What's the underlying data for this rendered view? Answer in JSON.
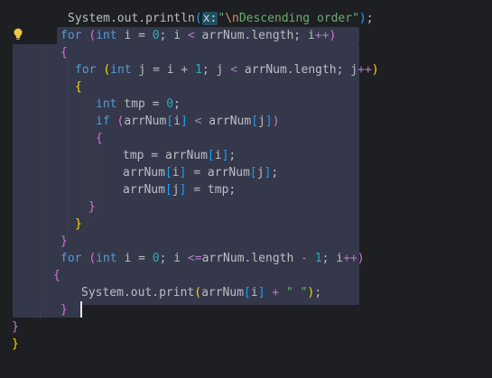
{
  "editor": {
    "icons": {
      "intention_bulb": "lightbulb-icon"
    },
    "colors": {
      "background": "#1e1f22",
      "selection": "#34384a",
      "keyword": "#569cd6",
      "number": "#2aacb8",
      "string": "#6aab73",
      "bracket_gold": "#ffd700",
      "bracket_magenta": "#da70d6",
      "bracket_blue": "#179fff"
    },
    "lines": [
      [
        {
          "t": "System.out.println",
          "c": "plain"
        },
        {
          "t": "(",
          "c": "br3"
        },
        {
          "t": "x:",
          "c": "hint"
        },
        {
          "t": "\"",
          "c": "str"
        },
        {
          "t": "\\n",
          "c": "esc"
        },
        {
          "t": "Descending order\"",
          "c": "str"
        },
        {
          "t": ")",
          "c": "br3"
        },
        {
          "t": ";",
          "c": "plain"
        }
      ],
      [
        {
          "t": "for",
          "c": "kw"
        },
        {
          "t": " ",
          "c": "plain"
        },
        {
          "t": "(",
          "c": "br2"
        },
        {
          "t": "int",
          "c": "kw"
        },
        {
          "t": " i = ",
          "c": "plain"
        },
        {
          "t": "0",
          "c": "num"
        },
        {
          "t": "; i ",
          "c": "plain"
        },
        {
          "t": "<",
          "c": "op"
        },
        {
          "t": " arrNum.length; i",
          "c": "plain"
        },
        {
          "t": "++",
          "c": "op"
        },
        {
          "t": ")",
          "c": "br2"
        }
      ],
      [
        {
          "t": "{",
          "c": "br2"
        }
      ],
      [
        {
          "t": "for",
          "c": "kw"
        },
        {
          "t": " ",
          "c": "plain"
        },
        {
          "t": "(",
          "c": "br1"
        },
        {
          "t": "int",
          "c": "kw"
        },
        {
          "t": " j = i + ",
          "c": "plain"
        },
        {
          "t": "1",
          "c": "num"
        },
        {
          "t": "; j ",
          "c": "plain"
        },
        {
          "t": "<",
          "c": "op"
        },
        {
          "t": " arrNum.length; j",
          "c": "plain"
        },
        {
          "t": "++",
          "c": "op"
        },
        {
          "t": ")",
          "c": "br1"
        }
      ],
      [
        {
          "t": "{",
          "c": "br1"
        }
      ],
      [
        {
          "t": "int",
          "c": "kw"
        },
        {
          "t": " tmp = ",
          "c": "plain"
        },
        {
          "t": "0",
          "c": "num"
        },
        {
          "t": ";",
          "c": "plain"
        }
      ],
      [
        {
          "t": "if",
          "c": "kw"
        },
        {
          "t": " ",
          "c": "plain"
        },
        {
          "t": "(",
          "c": "br2"
        },
        {
          "t": "arrNum",
          "c": "plain"
        },
        {
          "t": "[",
          "c": "br3"
        },
        {
          "t": "i",
          "c": "plain"
        },
        {
          "t": "]",
          "c": "br3"
        },
        {
          "t": " ",
          "c": "plain"
        },
        {
          "t": "<",
          "c": "op"
        },
        {
          "t": " arrNum",
          "c": "plain"
        },
        {
          "t": "[",
          "c": "br3"
        },
        {
          "t": "j",
          "c": "plain"
        },
        {
          "t": "]",
          "c": "br3"
        },
        {
          "t": ")",
          "c": "br2"
        }
      ],
      [
        {
          "t": "{",
          "c": "br2"
        }
      ],
      [
        {
          "t": "tmp = arrNum",
          "c": "plain"
        },
        {
          "t": "[",
          "c": "br3"
        },
        {
          "t": "i",
          "c": "plain"
        },
        {
          "t": "]",
          "c": "br3"
        },
        {
          "t": ";",
          "c": "plain"
        }
      ],
      [
        {
          "t": "arrNum",
          "c": "plain"
        },
        {
          "t": "[",
          "c": "br3"
        },
        {
          "t": "i",
          "c": "plain"
        },
        {
          "t": "]",
          "c": "br3"
        },
        {
          "t": " = arrNum",
          "c": "plain"
        },
        {
          "t": "[",
          "c": "br3"
        },
        {
          "t": "j",
          "c": "plain"
        },
        {
          "t": "]",
          "c": "br3"
        },
        {
          "t": ";",
          "c": "plain"
        }
      ],
      [
        {
          "t": "arrNum",
          "c": "plain"
        },
        {
          "t": "[",
          "c": "br3"
        },
        {
          "t": "j",
          "c": "plain"
        },
        {
          "t": "]",
          "c": "br3"
        },
        {
          "t": " = tmp;",
          "c": "plain"
        }
      ],
      [
        {
          "t": "}",
          "c": "br2"
        }
      ],
      [
        {
          "t": "}",
          "c": "br1"
        }
      ],
      [
        {
          "t": "}",
          "c": "br2"
        }
      ],
      [
        {
          "t": "for",
          "c": "kw"
        },
        {
          "t": " ",
          "c": "plain"
        },
        {
          "t": "(",
          "c": "br2"
        },
        {
          "t": "int",
          "c": "kw"
        },
        {
          "t": " i = ",
          "c": "plain"
        },
        {
          "t": "0",
          "c": "num"
        },
        {
          "t": "; i ",
          "c": "plain"
        },
        {
          "t": "<=",
          "c": "op"
        },
        {
          "t": "arrNum.length ",
          "c": "plain"
        },
        {
          "t": "-",
          "c": "op"
        },
        {
          "t": " ",
          "c": "plain"
        },
        {
          "t": "1",
          "c": "num"
        },
        {
          "t": "; i",
          "c": "plain"
        },
        {
          "t": "++",
          "c": "op"
        },
        {
          "t": ")",
          "c": "br2"
        }
      ],
      [
        {
          "t": "{",
          "c": "br2"
        }
      ],
      [
        {
          "t": "System.out.print",
          "c": "plain"
        },
        {
          "t": "(",
          "c": "br1"
        },
        {
          "t": "arrNum",
          "c": "plain"
        },
        {
          "t": "[",
          "c": "br3"
        },
        {
          "t": "i",
          "c": "plain"
        },
        {
          "t": "]",
          "c": "br3"
        },
        {
          "t": " ",
          "c": "plain"
        },
        {
          "t": "+",
          "c": "op"
        },
        {
          "t": " ",
          "c": "plain"
        },
        {
          "t": "\" \"",
          "c": "str"
        },
        {
          "t": ")",
          "c": "br1"
        },
        {
          "t": ";",
          "c": "plain"
        }
      ],
      [
        {
          "t": "}",
          "c": "br2"
        }
      ],
      [
        {
          "t": "}",
          "c": "br2"
        }
      ],
      [
        {
          "t": "}",
          "c": "br1"
        }
      ]
    ]
  }
}
